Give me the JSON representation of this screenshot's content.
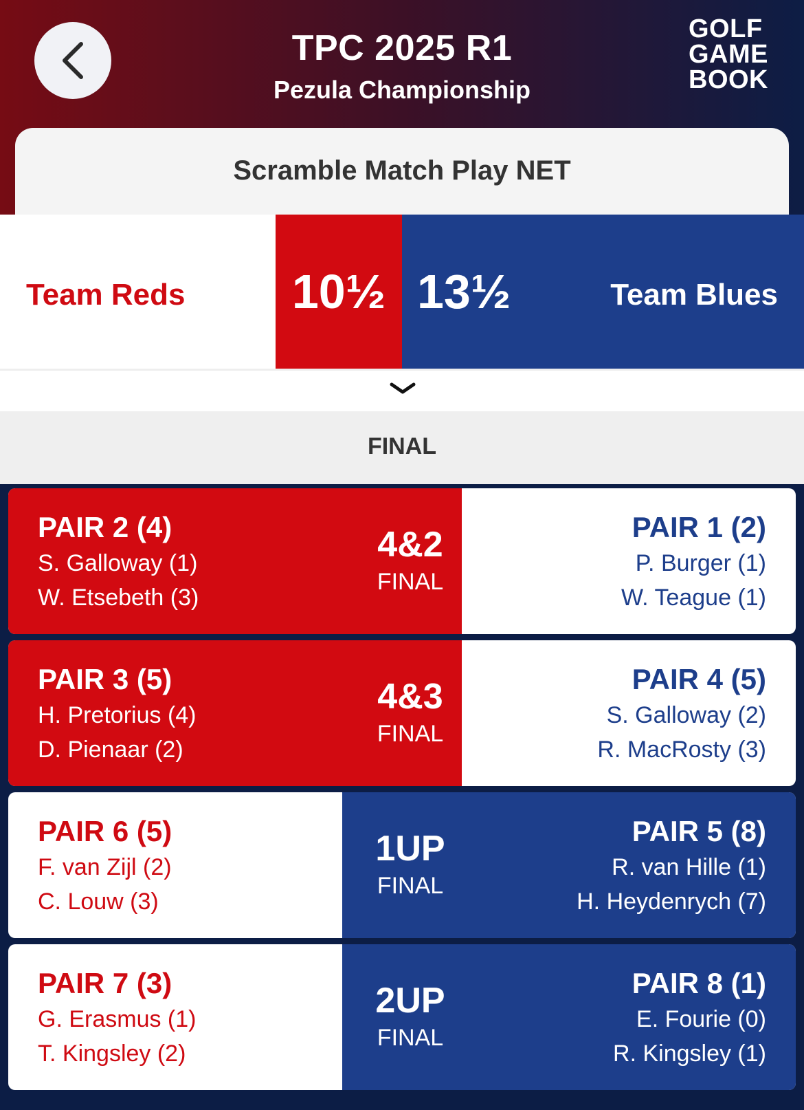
{
  "header": {
    "title": "TPC 2025 R1",
    "subtitle": "Pezula Championship",
    "logo_lines": [
      "GOLF",
      "GAME",
      "BOOK"
    ]
  },
  "format": "Scramble Match Play NET",
  "teams": {
    "red": {
      "name": "Team Reds",
      "score": "10½",
      "color": "#d20a11"
    },
    "blue": {
      "name": "Team Blues",
      "score": "13½",
      "color": "#1d3e8b"
    }
  },
  "status": "FINAL",
  "matches": [
    {
      "left": {
        "title": "PAIR 2 (4)",
        "players": [
          "S. Galloway (1)",
          "W. Etsebeth (3)"
        ]
      },
      "result": "4&2",
      "result_status": "FINAL",
      "right": {
        "title": "PAIR 1 (2)",
        "players": [
          "P. Burger (1)",
          "W. Teague (1)"
        ]
      },
      "winner": "red"
    },
    {
      "left": {
        "title": "PAIR 3 (5)",
        "players": [
          "H. Pretorius (4)",
          "D. Pienaar (2)"
        ]
      },
      "result": "4&3",
      "result_status": "FINAL",
      "right": {
        "title": "PAIR 4 (5)",
        "players": [
          "S. Galloway (2)",
          "R. MacRosty (3)"
        ]
      },
      "winner": "red"
    },
    {
      "left": {
        "title": "PAIR 6 (5)",
        "players": [
          "F. van Zijl (2)",
          "C. Louw (3)"
        ]
      },
      "result": "1UP",
      "result_status": "FINAL",
      "right": {
        "title": "PAIR 5 (8)",
        "players": [
          "R. van Hille (1)",
          "H. Heydenrych (7)"
        ]
      },
      "winner": "blue"
    },
    {
      "left": {
        "title": "PAIR 7 (3)",
        "players": [
          "G. Erasmus (1)",
          "T. Kingsley (2)"
        ]
      },
      "result": "2UP",
      "result_status": "FINAL",
      "right": {
        "title": "PAIR 8 (1)",
        "players": [
          "E. Fourie (0)",
          "R. Kingsley (1)"
        ]
      },
      "winner": "blue"
    }
  ]
}
